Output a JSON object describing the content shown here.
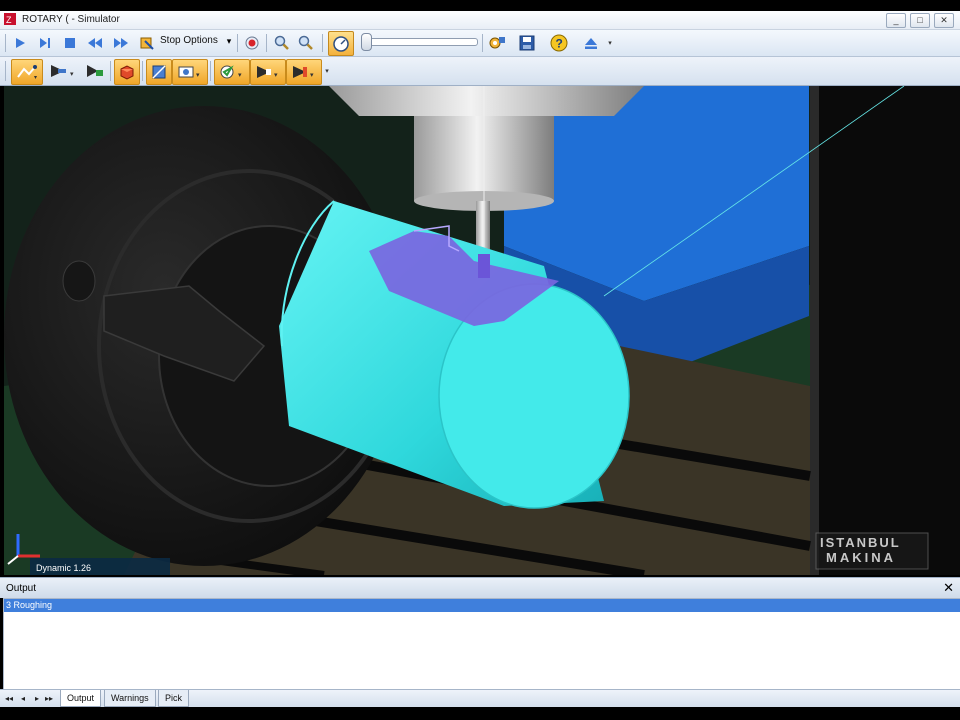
{
  "window": {
    "title": "ROTARY ( - Simulator",
    "controls": [
      "_",
      "□",
      "✕"
    ],
    "app_icon": "logo-icon"
  },
  "toolbar1": {
    "stop_options_label": "Stop Options",
    "dropdown_arrow": "▾",
    "icons": [
      "play-icon",
      "step-icon",
      "stop-icon",
      "rewind-icon",
      "fast-forward-icon",
      "pan-icon",
      "dropdown-arrow-icon",
      "record-icon",
      "zoom-in-icon",
      "zoom-out-icon",
      "speed-gauge-icon",
      "speed-slider",
      "settings-icon",
      "save-icon",
      "help-icon",
      "eject-icon"
    ]
  },
  "toolbar2": {
    "icons": [
      "toolpath-icon",
      "tool-arrow-icon",
      "tool-axis-icon",
      "stock-icon",
      "cut-color-icon",
      "machine-icon",
      "verify-icon",
      "fixture-icon",
      "cutter-icon"
    ]
  },
  "viewport": {
    "status_text": "Dynamic 1.26",
    "watermark_line1": "ISTANBUL",
    "watermark_line2": "MAKINA",
    "colors": {
      "stock": "#3fe6e6",
      "cut_region": "#7a66e0",
      "machine_body": "#1c1c1c",
      "background_blue": "#1f6fd6",
      "table": "#3a3426"
    }
  },
  "output": {
    "title": "Output",
    "close": "✕",
    "rows": [
      "3 Roughing"
    ]
  },
  "bottom": {
    "nav": [
      "◂◂",
      "◂",
      "▸",
      "▸▸"
    ],
    "tabs": [
      "Output",
      "Warnings",
      "Pick"
    ]
  }
}
